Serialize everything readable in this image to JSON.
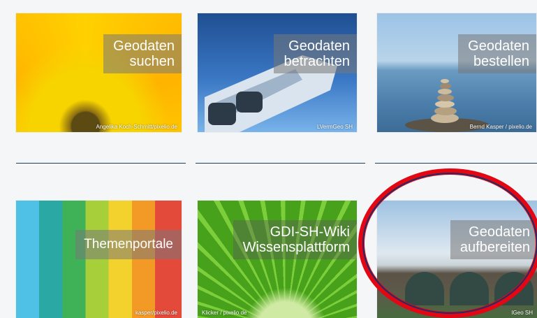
{
  "tiles": [
    {
      "label_line1": "Geodaten",
      "label_line2": "suchen",
      "credit": "Angelika Koch-Schmitt/pixelio.de"
    },
    {
      "label_line1": "Geodaten",
      "label_line2": "betrachten",
      "credit": "LVermGeo SH"
    },
    {
      "label_line1": "Geodaten",
      "label_line2": "bestellen",
      "credit": "Bernd Kasper / pixelio.de"
    },
    {
      "label_line1": "Themenportale",
      "label_line2": "",
      "credit": "kasper/pixelio.de"
    },
    {
      "label_line1": "GDI-SH-Wiki",
      "label_line2": "Wissensplattform",
      "credit": "Klicker / pixelio.de"
    },
    {
      "label_line1": "Geodaten",
      "label_line2": "aufbereiten",
      "credit": "lGeo SH"
    }
  ],
  "annotation": {
    "color": "#e30613",
    "highlighted_tile": "Geodaten aufbereiten"
  }
}
